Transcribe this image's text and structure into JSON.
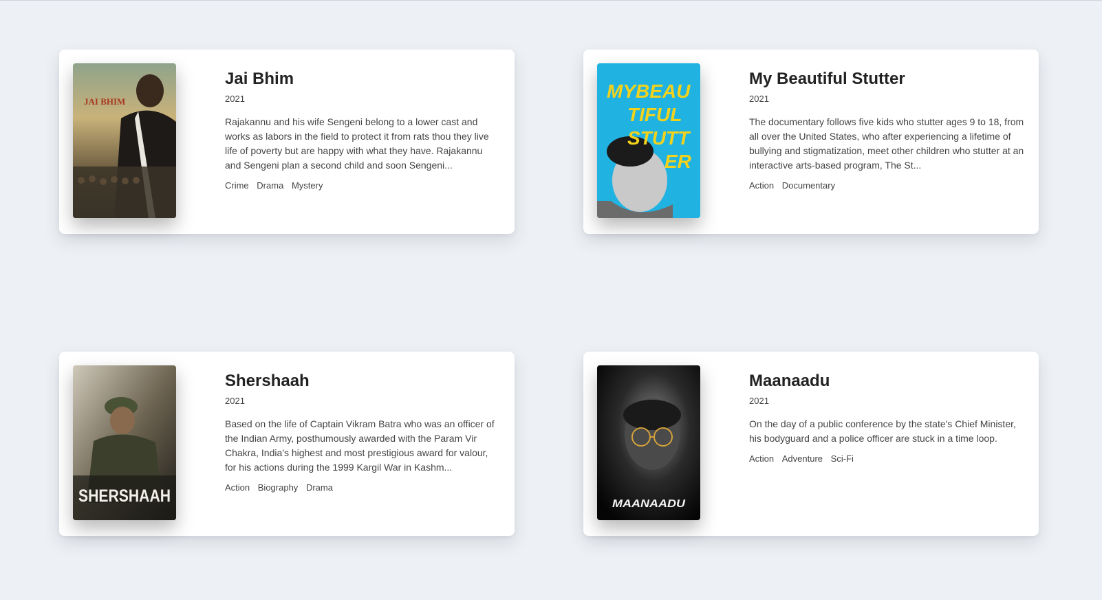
{
  "movies": [
    {
      "title": "Jai Bhim",
      "year": "2021",
      "overview": "Rajakannu and his wife Sengeni belong to a lower cast and works as labors in the field to protect it from rats thou they live life of poverty but are happy with what they have. Rajakannu and Sengeni plan a second child and soon Sengeni...",
      "genres": [
        "Crime",
        "Drama",
        "Mystery"
      ],
      "poster_text": "JAI BHIM"
    },
    {
      "title": "My Beautiful Stutter",
      "year": "2021",
      "overview": "The documentary follows five kids who stutter ages 9 to 18, from all over the United States, who after experiencing a lifetime of bullying and stigmatization, meet other children who stutter at an interactive arts-based program, The St...",
      "genres": [
        "Action",
        "Documentary"
      ],
      "poster_text_lines": [
        "MYBEAU",
        "TIFUL",
        "STUTT",
        "ER"
      ]
    },
    {
      "title": "Shershaah",
      "year": "2021",
      "overview": "Based on the life of Captain Vikram Batra who was an officer of the Indian Army, posthumously awarded with the Param Vir Chakra, India's highest and most prestigious award for valour, for his actions during the 1999 Kargil War in Kashm...",
      "genres": [
        "Action",
        "Biography",
        "Drama"
      ],
      "poster_text": "SHERSHAAH"
    },
    {
      "title": "Maanaadu",
      "year": "2021",
      "overview": "On the day of a public conference by the state's Chief Minister, his bodyguard and a police officer are stuck in a time loop.",
      "genres": [
        "Action",
        "Adventure",
        "Sci-Fi"
      ],
      "poster_text": "MAANAADU"
    }
  ]
}
